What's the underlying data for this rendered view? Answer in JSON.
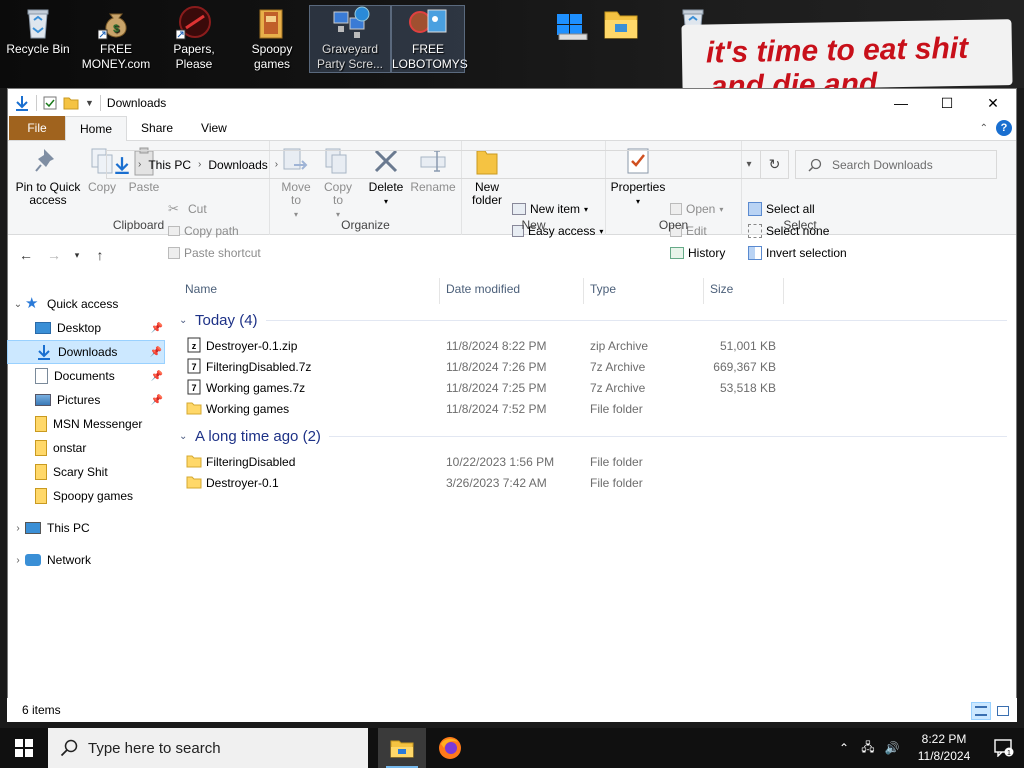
{
  "desktop": {
    "icons": [
      {
        "label": "Recycle Bin",
        "icon": "recycle-bin-icon"
      },
      {
        "label": "FREE MONEY.com",
        "icon": "money-bag-icon"
      },
      {
        "label": "Papers, Please",
        "icon": "papers-please-icon"
      },
      {
        "label": "Spoopy games",
        "icon": "folder-icon"
      },
      {
        "label": "Graveyard Party Scre...",
        "icon": "network-computers-icon"
      },
      {
        "label": "FREE LOBOTOMYS",
        "icon": "lobotomy-icon"
      },
      {
        "label": "",
        "icon": "drive-icon"
      },
      {
        "label": "",
        "icon": "folder-icon"
      },
      {
        "label": "",
        "icon": "recycle-bin-icon"
      }
    ],
    "meme_text_line1": "it's time to eat shit",
    "meme_text_line2": "and die and ..."
  },
  "window": {
    "title": "Downloads",
    "controls": {
      "minimize": "—",
      "maximize": "☐",
      "close": "✕"
    }
  },
  "ribbon": {
    "tabs": [
      "File",
      "Home",
      "Share",
      "View"
    ],
    "active_tab": "Home",
    "clipboard": {
      "name": "Clipboard",
      "pin": "Pin to Quick access",
      "copy": "Copy",
      "paste": "Paste",
      "cut": "Cut",
      "copy_path": "Copy path",
      "paste_shortcut": "Paste shortcut"
    },
    "organize": {
      "name": "Organize",
      "move_to": "Move to",
      "copy_to": "Copy to",
      "delete": "Delete",
      "rename": "Rename"
    },
    "new": {
      "name": "New",
      "new_folder": "New folder",
      "new_item": "New item",
      "easy_access": "Easy access"
    },
    "open": {
      "name": "Open",
      "properties": "Properties",
      "open": "Open",
      "edit": "Edit",
      "history": "History"
    },
    "select": {
      "name": "Select",
      "select_all": "Select all",
      "select_none": "Select none",
      "invert_selection": "Invert selection"
    }
  },
  "address": {
    "crumbs": [
      "This PC",
      "Downloads"
    ],
    "search_placeholder": "Search Downloads"
  },
  "navpane": {
    "quick_access": "Quick access",
    "items": [
      {
        "label": "Desktop",
        "pinned": true
      },
      {
        "label": "Downloads",
        "pinned": true,
        "selected": true
      },
      {
        "label": "Documents",
        "pinned": true
      },
      {
        "label": "Pictures",
        "pinned": true
      },
      {
        "label": "MSN Messenger",
        "pinned": false
      },
      {
        "label": "onstar",
        "pinned": false
      },
      {
        "label": "Scary Shit",
        "pinned": false
      },
      {
        "label": "Spoopy games",
        "pinned": false
      }
    ],
    "this_pc": "This PC",
    "network": "Network"
  },
  "columns": {
    "name": "Name",
    "date": "Date modified",
    "type": "Type",
    "size": "Size"
  },
  "groups": [
    {
      "title": "Today (4)",
      "files": [
        {
          "name": "Destroyer-0.1.zip",
          "date": "11/8/2024 8:22 PM",
          "type": "zip Archive",
          "size": "51,001 KB",
          "kind": "archive"
        },
        {
          "name": "FilteringDisabled.7z",
          "date": "11/8/2024 7:26 PM",
          "type": "7z Archive",
          "size": "669,367 KB",
          "kind": "archive"
        },
        {
          "name": "Working games.7z",
          "date": "11/8/2024 7:25 PM",
          "type": "7z Archive",
          "size": "53,518 KB",
          "kind": "archive"
        },
        {
          "name": "Working games",
          "date": "11/8/2024 7:52 PM",
          "type": "File folder",
          "size": "",
          "kind": "folder"
        }
      ]
    },
    {
      "title": "A long time ago (2)",
      "files": [
        {
          "name": "FilteringDisabled",
          "date": "10/22/2023 1:56 PM",
          "type": "File folder",
          "size": "",
          "kind": "folder"
        },
        {
          "name": "Destroyer-0.1",
          "date": "3/26/2023 7:42 AM",
          "type": "File folder",
          "size": "",
          "kind": "folder"
        }
      ]
    }
  ],
  "status": {
    "items": "6 items"
  },
  "taskbar": {
    "search_placeholder": "Type here to search",
    "time": "8:22 PM",
    "date": "11/8/2024",
    "notifications": "1"
  },
  "colors": {
    "accent": "#0078d7",
    "file_tab": "#a0631e",
    "selection": "#cce8ff",
    "group_header": "#1e3287"
  }
}
